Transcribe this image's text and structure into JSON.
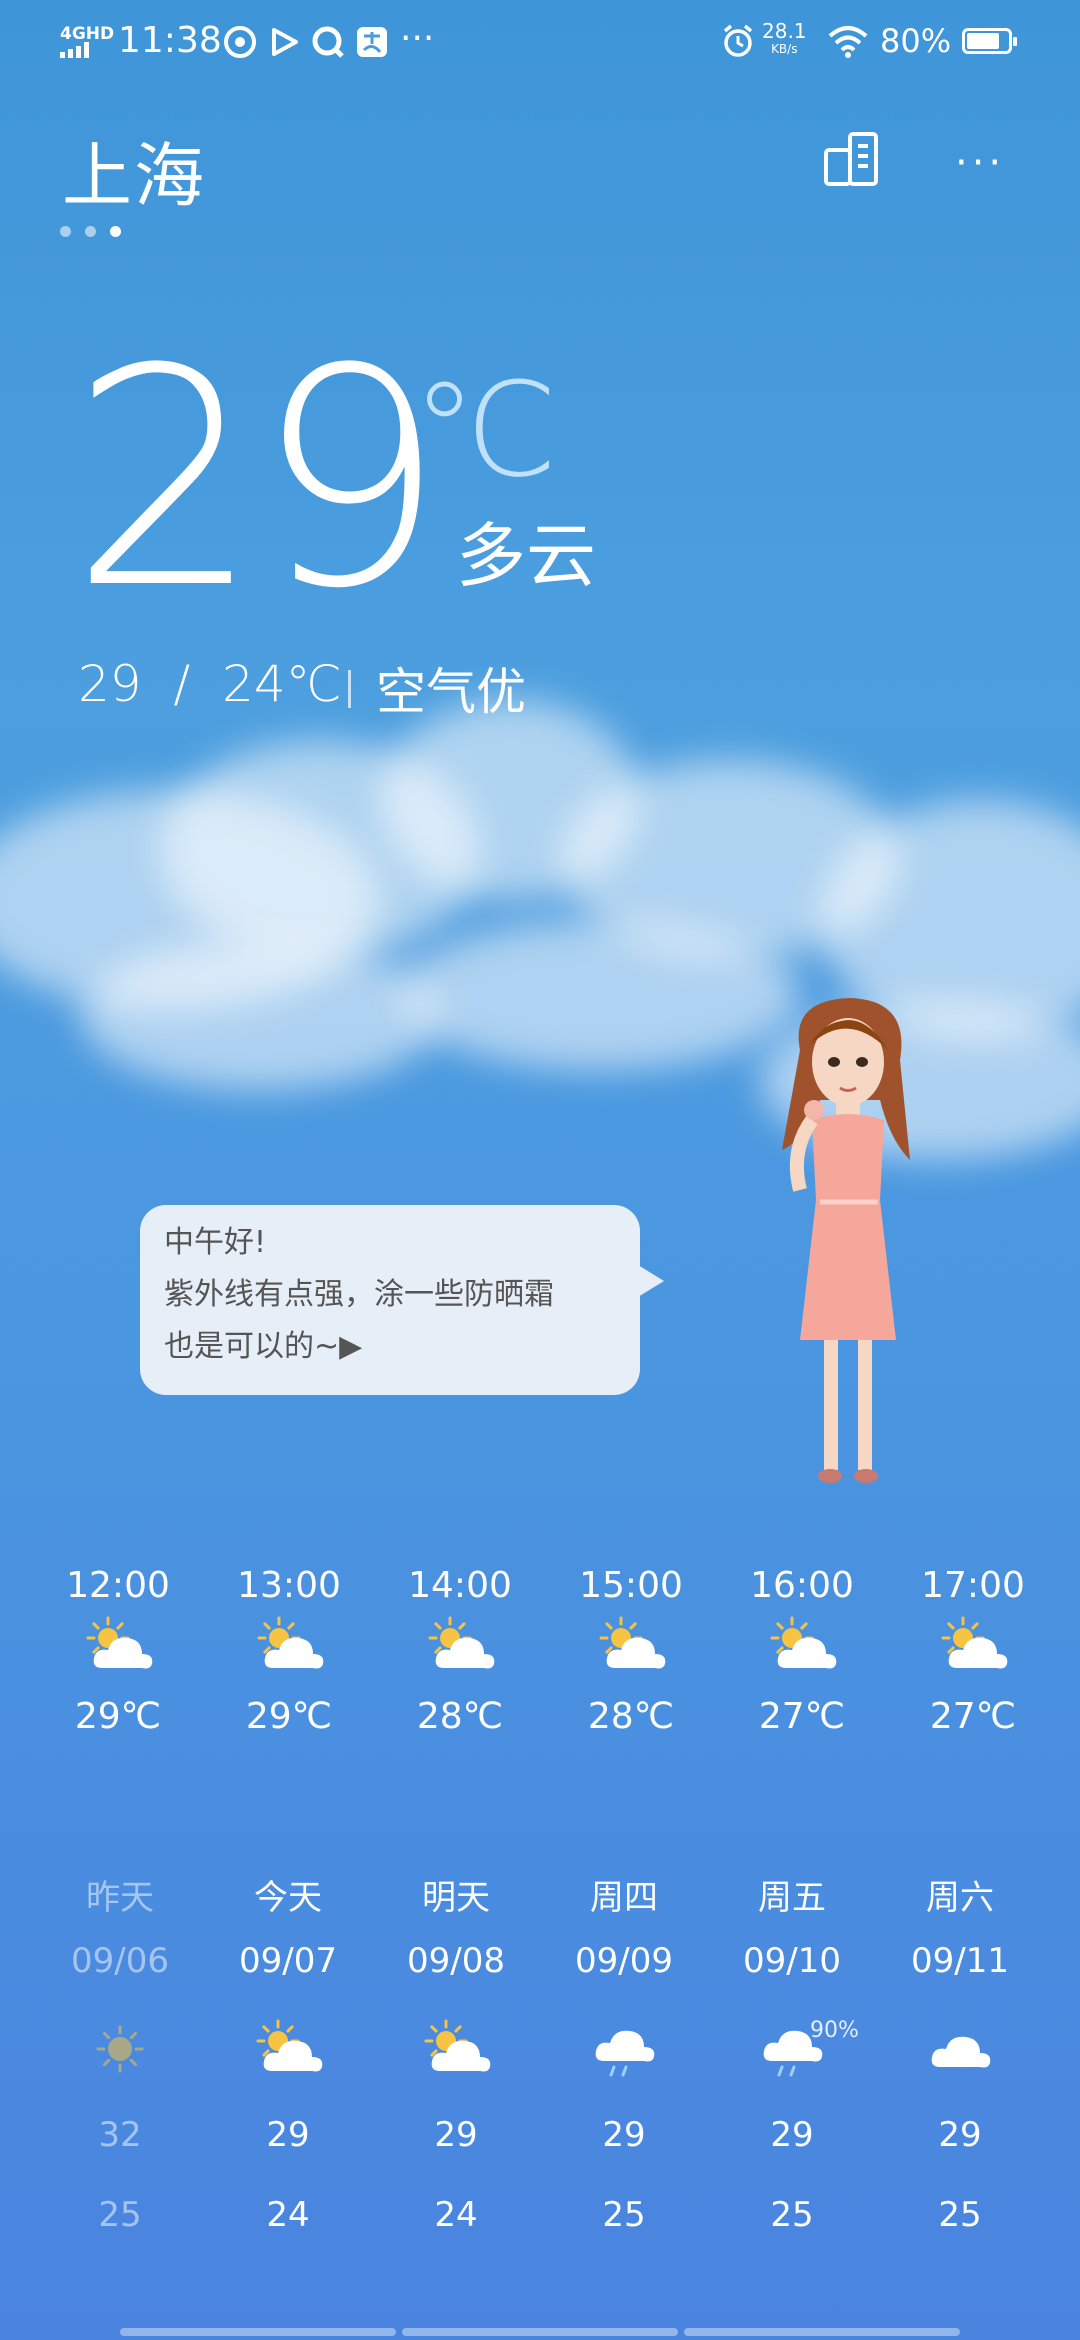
{
  "status_bar": {
    "time": "11:38",
    "network": "4GHD",
    "speed_value": "28.1",
    "speed_unit": "KB/s",
    "battery_text": "80%",
    "battery_level": 0.8,
    "more": "···"
  },
  "header": {
    "city": "上海",
    "page_count": 3,
    "active_page": 2,
    "menu": "···"
  },
  "current": {
    "temp": "29",
    "unit": "℃",
    "condition": "多云",
    "range": "29  /  24℃",
    "aqi": "空气优"
  },
  "bubble": {
    "line1": "中午好!",
    "line2": "紫外线有点强，涂一些防晒霜",
    "line3": "也是可以的~▶"
  },
  "hourly": [
    {
      "time": "12:00",
      "icon": "partly-cloudy-icon",
      "temp": "29℃"
    },
    {
      "time": "13:00",
      "icon": "partly-cloudy-icon",
      "temp": "29℃"
    },
    {
      "time": "14:00",
      "icon": "partly-cloudy-icon",
      "temp": "28℃"
    },
    {
      "time": "15:00",
      "icon": "partly-cloudy-icon",
      "temp": "28℃"
    },
    {
      "time": "16:00",
      "icon": "partly-cloudy-icon",
      "temp": "27℃"
    },
    {
      "time": "17:00",
      "icon": "partly-cloudy-icon",
      "temp": "27℃"
    }
  ],
  "daily": [
    {
      "day": "昨天",
      "date": "09/06",
      "icon": "sunny-icon",
      "hi": "32",
      "lo": "25"
    },
    {
      "day": "今天",
      "date": "09/07",
      "icon": "partly-cloudy-icon",
      "hi": "29",
      "lo": "24"
    },
    {
      "day": "明天",
      "date": "09/08",
      "icon": "partly-cloudy-icon",
      "hi": "29",
      "lo": "24"
    },
    {
      "day": "周四",
      "date": "09/09",
      "icon": "rain-icon",
      "hi": "29",
      "lo": "25"
    },
    {
      "day": "周五",
      "date": "09/10",
      "icon": "rain-icon",
      "hi": "29",
      "lo": "25",
      "pop": "90%"
    },
    {
      "day": "周六",
      "date": "09/11",
      "icon": "cloudy-icon",
      "hi": "29",
      "lo": "25"
    }
  ],
  "colors": {
    "sky_top": "#3e95d8",
    "sky_bottom": "#4a84df",
    "sun": "#f6c343",
    "bubble_bg": "#e6eff8"
  }
}
